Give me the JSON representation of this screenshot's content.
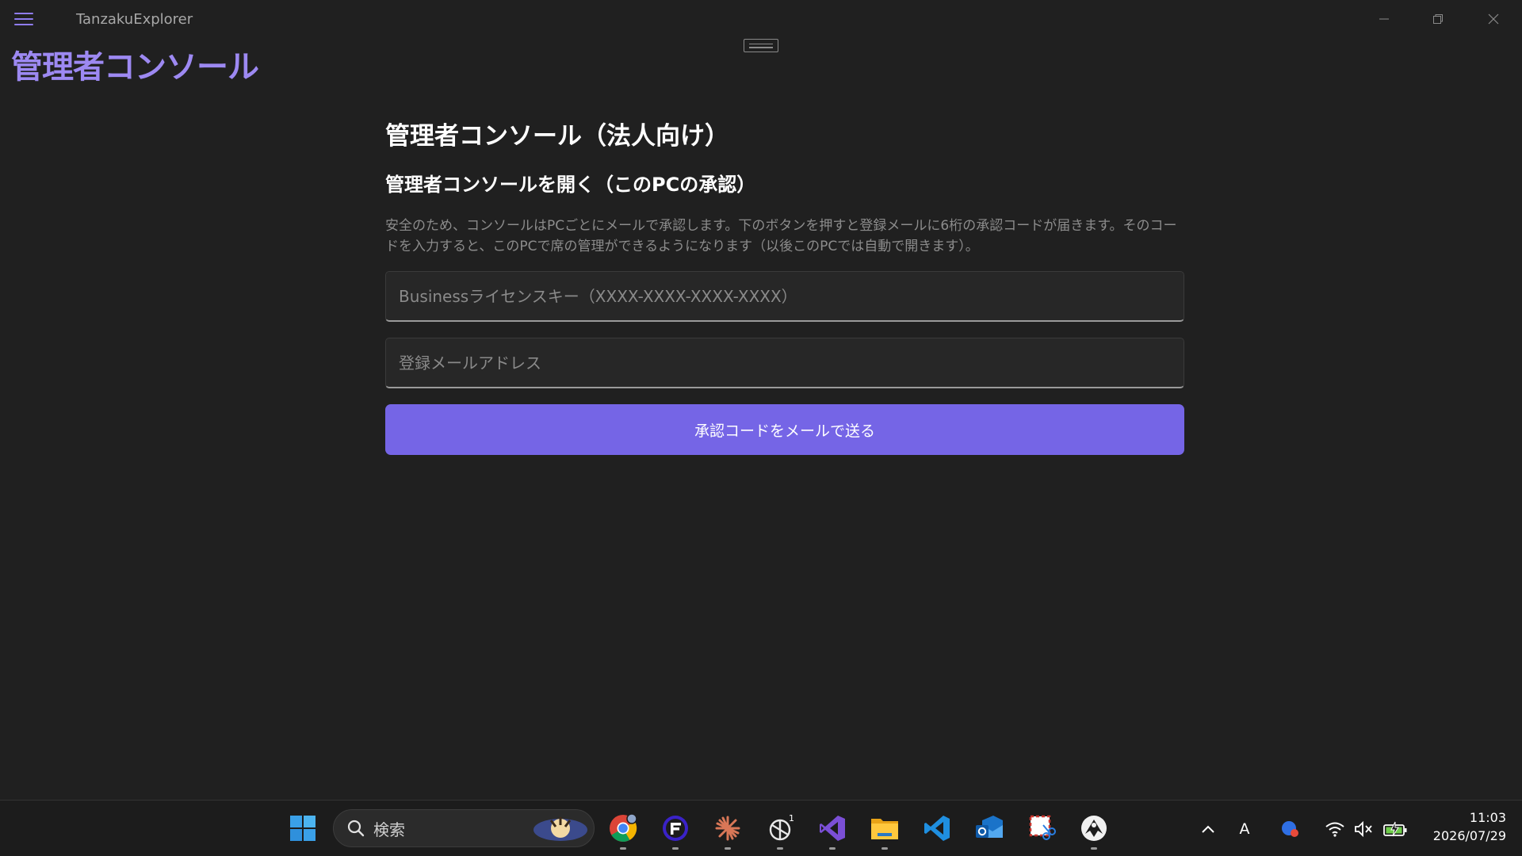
{
  "app": {
    "title": "TanzakuExplorer",
    "page_heading": "管理者コンソール"
  },
  "main": {
    "title": "管理者コンソール（法人向け）",
    "subtitle": "管理者コンソールを開く（このPCの承認）",
    "description": "安全のため、コンソールはPCごとにメールで承認します。下のボタンを押すと登録メールに6桁の承認コードが届きます。そのコードを入力すると、このPCで席の管理ができるようになります（以後このPCでは自動で開きます）。",
    "license_input": {
      "value": "",
      "placeholder": "Businessライセンスキー（XXXX-XXXX-XXXX-XXXX）"
    },
    "email_input": {
      "value": "",
      "placeholder": "登録メールアドレス"
    },
    "send_button_label": "承認コードをメールで送る"
  },
  "colors": {
    "accent": "#7565e6",
    "heading_accent": "#9d89f2",
    "background": "#202020"
  },
  "taskbar": {
    "search_label": "検索",
    "apps": [
      {
        "name": "start-icon"
      },
      {
        "name": "chrome-icon"
      },
      {
        "name": "app-f-icon"
      },
      {
        "name": "claude-icon"
      },
      {
        "name": "chatgpt-icon",
        "badge": "1"
      },
      {
        "name": "visual-studio-icon"
      },
      {
        "name": "file-explorer-icon"
      },
      {
        "name": "vscode-icon"
      },
      {
        "name": "outlook-icon"
      },
      {
        "name": "snipping-tool-icon"
      },
      {
        "name": "inkscape-icon"
      }
    ],
    "tray": {
      "ime_label": "A",
      "time": "11:03",
      "date": "2026/07/29"
    }
  }
}
